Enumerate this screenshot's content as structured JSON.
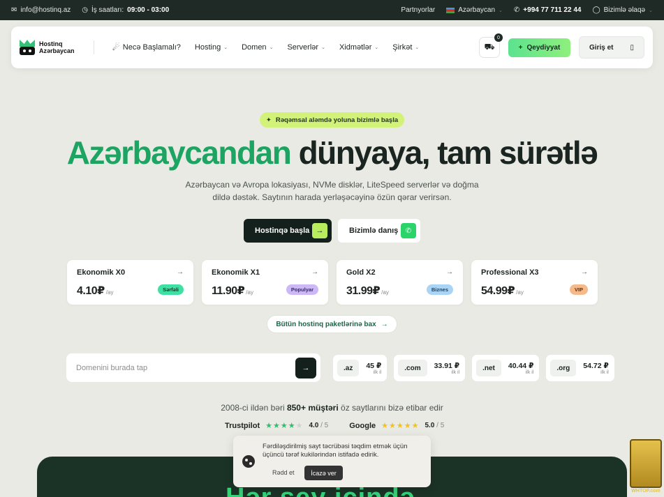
{
  "topbar": {
    "email": "info@hostinq.az",
    "hours_label": "İş saatları:",
    "hours_value": "09:00 - 03:00",
    "partners": "Partnyorlar",
    "country": "Azərbaycan",
    "phone": "+994 77 711 22 44",
    "contact": "Bizimlə əlaqə"
  },
  "nav": {
    "logo_line1": "Hostinq",
    "logo_line2": "Azərbaycan",
    "getting_started": "Necə Başlamalı?",
    "items": [
      "Hosting",
      "Domen",
      "Serverlər",
      "Xidmətlər",
      "Şirkət"
    ],
    "cart_count": "0",
    "register": "Qeydiyyat",
    "login": "Giriş et"
  },
  "hero": {
    "pill": "Rəqəmsal aləmdə yoluna bizimlə başla",
    "title_green": "Azərbaycandan",
    "title_rest": "dünyaya, tam sürətlə",
    "subtitle_line1": "Azərbaycan və Avropa lokasiyası, NVMe disklər, LiteSpeed serverlər və doğma",
    "subtitle_line2": "dildə dəstək. Saytının harada yerləşəcəyinə özün qərar verirsən.",
    "cta_primary": "Hostinqə başla",
    "cta_secondary": "Bizimlə danış"
  },
  "plans": [
    {
      "name": "Ekonomik X0",
      "price": "4.10₽",
      "period": "/ay",
      "tag": "Sərfəli",
      "tag_bg": "#3fe0a4",
      "tag_fg": "#0f3a27"
    },
    {
      "name": "Ekonomik X1",
      "price": "11.90₽",
      "period": "/ay",
      "tag": "Populyar",
      "tag_bg": "#cbb8f4",
      "tag_fg": "#3b2a6b"
    },
    {
      "name": "Gold X2",
      "price": "31.99₽",
      "period": "/ay",
      "tag": "Biznes",
      "tag_bg": "#a9d4f5",
      "tag_fg": "#1e4663"
    },
    {
      "name": "Professional X3",
      "price": "54.99₽",
      "period": "/ay",
      "tag": "VIP",
      "tag_bg": "#f6b98a",
      "tag_fg": "#5e2f10"
    }
  ],
  "all_plans": "Bütün hostinq paketlərinə bax",
  "domain": {
    "placeholder": "Domenini burada tap",
    "tlds": [
      {
        "ext": ".az",
        "price": "45 ₽",
        "period": "ilk il"
      },
      {
        "ext": ".com",
        "price": "33.91 ₽",
        "period": "ilk il"
      },
      {
        "ext": ".net",
        "price": "40.44 ₽",
        "period": "ilk il"
      },
      {
        "ext": ".org",
        "price": "54.72 ₽",
        "period": "ilk il"
      }
    ]
  },
  "trust": {
    "pre": "2008-ci ildən bəri",
    "bold": "850+ müştəri",
    "post": "öz saytlarını bizə etibar edir",
    "trustpilot": {
      "name": "Trustpilot",
      "score": "4.0",
      "max": "/ 5"
    },
    "google": {
      "name": "Google",
      "score": "5.0",
      "max": "/ 5"
    }
  },
  "section_peek": "Hər şey içində",
  "cookie": {
    "text": "Fərdiləşdirilmiş sayt təcrübəsi təqdim etmək üçün üçüncü tərəf kukilərindən istifadə edirik.",
    "reject": "Rədd et",
    "accept": "İcazə ver"
  },
  "watermark": "WHTOP.com"
}
